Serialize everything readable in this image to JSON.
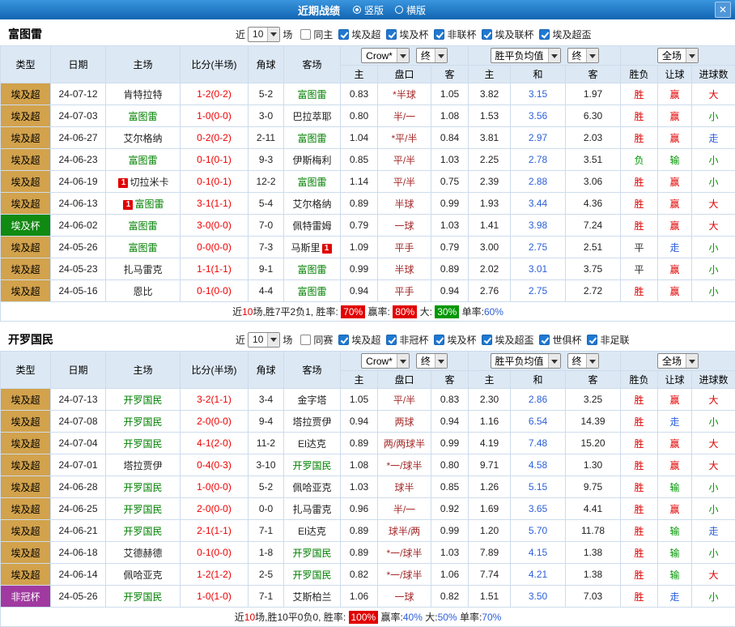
{
  "titlebar": {
    "title": "近期战绩",
    "portrait_label": "竖版",
    "landscape_label": "横版",
    "close_icon": "✕"
  },
  "colors": {
    "win": "#e10000",
    "draw": "#333333",
    "loss": "#009700",
    "push": "#2b5fd9",
    "over": "#e10000",
    "under": "#009700",
    "team": "#008000",
    "score": "#ee0000",
    "handicap": "#a52a2a",
    "league_bg": "#d2a24c",
    "cup_bg": "#118a11",
    "confed_bg": "#a03aa0"
  },
  "sections": [
    {
      "team": "富图雷",
      "filters": {
        "near_label": "近",
        "count": "10",
        "matches_label": "场",
        "checks": [
          {
            "label": "同主",
            "checked": false
          },
          {
            "label": "埃及超",
            "checked": true
          },
          {
            "label": "埃及杯",
            "checked": true
          },
          {
            "label": "非联杯",
            "checked": true
          },
          {
            "label": "埃及联杯",
            "checked": true
          },
          {
            "label": "埃及超盃",
            "checked": true
          }
        ]
      },
      "selects": {
        "book": "Crow*",
        "final1": "终",
        "avg": "胜平负均值",
        "final2": "终",
        "scope": "全场"
      },
      "cols_main": [
        "类型",
        "日期",
        "主场",
        "比分(半场)",
        "角球",
        "客场"
      ],
      "cols_sub": [
        "主",
        "盘口",
        "客",
        "主",
        "和",
        "客",
        "胜负",
        "让球",
        "进球数"
      ],
      "rows": [
        {
          "type": "埃及超",
          "tc": "league",
          "date": "24-07-12",
          "home": {
            "name": "肯特拉特"
          },
          "score": "1-2(0-2)",
          "corner": "5-2",
          "away": {
            "name": "富图雷"
          },
          "odds": [
            "0.83",
            "*半球",
            "1.05"
          ],
          "avg": [
            "3.82",
            "3.15",
            "1.97"
          ],
          "res": [
            "胜",
            "赢",
            "大"
          ]
        },
        {
          "type": "埃及超",
          "tc": "league",
          "date": "24-07-03",
          "home": {
            "name": "富图雷"
          },
          "score": "1-0(0-0)",
          "corner": "3-0",
          "away": {
            "name": "巴拉萃耶"
          },
          "odds": [
            "0.80",
            "半/一",
            "1.08"
          ],
          "avg": [
            "1.53",
            "3.56",
            "6.30"
          ],
          "res": [
            "胜",
            "赢",
            "小"
          ]
        },
        {
          "type": "埃及超",
          "tc": "league",
          "date": "24-06-27",
          "home": {
            "name": "艾尔格纳"
          },
          "score": "0-2(0-2)",
          "corner": "2-11",
          "away": {
            "name": "富图雷"
          },
          "odds": [
            "1.04",
            "*平/半",
            "0.84"
          ],
          "avg": [
            "3.81",
            "2.97",
            "2.03"
          ],
          "res": [
            "胜",
            "赢",
            "走"
          ]
        },
        {
          "type": "埃及超",
          "tc": "league",
          "date": "24-06-23",
          "home": {
            "name": "富图雷"
          },
          "score": "0-1(0-1)",
          "corner": "9-3",
          "away": {
            "name": "伊斯梅利"
          },
          "odds": [
            "0.85",
            "平/半",
            "1.03"
          ],
          "avg": [
            "2.25",
            "2.78",
            "3.51"
          ],
          "res": [
            "负",
            "输",
            "小"
          ]
        },
        {
          "type": "埃及超",
          "tc": "league",
          "date": "24-06-19",
          "home": {
            "name": "切拉米卡",
            "badge": "1",
            "badge_pos": "left"
          },
          "score": "0-1(0-1)",
          "corner": "12-2",
          "away": {
            "name": "富图雷"
          },
          "odds": [
            "1.14",
            "平/半",
            "0.75"
          ],
          "avg": [
            "2.39",
            "2.88",
            "3.06"
          ],
          "res": [
            "胜",
            "赢",
            "小"
          ]
        },
        {
          "type": "埃及超",
          "tc": "league",
          "date": "24-06-13",
          "home": {
            "name": "富图雷",
            "badge": "1",
            "badge_pos": "left"
          },
          "score": "3-1(1-1)",
          "corner": "5-4",
          "away": {
            "name": "艾尔格纳"
          },
          "odds": [
            "0.89",
            "半球",
            "0.99"
          ],
          "avg": [
            "1.93",
            "3.44",
            "4.36"
          ],
          "res": [
            "胜",
            "赢",
            "大"
          ]
        },
        {
          "type": "埃及杯",
          "tc": "cup",
          "date": "24-06-02",
          "home": {
            "name": "富图雷"
          },
          "score": "3-0(0-0)",
          "corner": "7-0",
          "away": {
            "name": "佩特雷姆"
          },
          "odds": [
            "0.79",
            "一球",
            "1.03"
          ],
          "avg": [
            "1.41",
            "3.98",
            "7.24"
          ],
          "res": [
            "胜",
            "赢",
            "大"
          ]
        },
        {
          "type": "埃及超",
          "tc": "league",
          "date": "24-05-26",
          "home": {
            "name": "富图雷"
          },
          "score": "0-0(0-0)",
          "corner": "7-3",
          "away": {
            "name": "马斯里",
            "badge": "1",
            "badge_pos": "right"
          },
          "odds": [
            "1.09",
            "平手",
            "0.79"
          ],
          "avg": [
            "3.00",
            "2.75",
            "2.51"
          ],
          "res": [
            "平",
            "走",
            "小"
          ]
        },
        {
          "type": "埃及超",
          "tc": "league",
          "date": "24-05-23",
          "home": {
            "name": "扎马雷克"
          },
          "score": "1-1(1-1)",
          "corner": "9-1",
          "away": {
            "name": "富图雷"
          },
          "odds": [
            "0.99",
            "半球",
            "0.89"
          ],
          "avg": [
            "2.02",
            "3.01",
            "3.75"
          ],
          "res": [
            "平",
            "赢",
            "小"
          ]
        },
        {
          "type": "埃及超",
          "tc": "league",
          "date": "24-05-16",
          "home": {
            "name": "恩比"
          },
          "score": "0-1(0-0)",
          "corner": "4-4",
          "away": {
            "name": "富图雷"
          },
          "odds": [
            "0.94",
            "平手",
            "0.94"
          ],
          "avg": [
            "2.76",
            "2.75",
            "2.72"
          ],
          "res": [
            "胜",
            "赢",
            "小"
          ]
        }
      ],
      "summary": [
        {
          "t": "近"
        },
        {
          "t": "10",
          "c": "red"
        },
        {
          "t": "场,胜7平2负1, 胜率: "
        },
        {
          "t": "70%",
          "c": "badge-red"
        },
        {
          "t": " 赢率: "
        },
        {
          "t": "80%",
          "c": "badge-red"
        },
        {
          "t": " 大: "
        },
        {
          "t": "30%",
          "c": "badge-green"
        },
        {
          "t": " 单率:"
        },
        {
          "t": "60%",
          "c": "blue"
        }
      ]
    },
    {
      "team": "开罗国民",
      "filters": {
        "near_label": "近",
        "count": "10",
        "matches_label": "场",
        "checks": [
          {
            "label": "同赛",
            "checked": false
          },
          {
            "label": "埃及超",
            "checked": true
          },
          {
            "label": "非冠杯",
            "checked": true
          },
          {
            "label": "埃及杯",
            "checked": true
          },
          {
            "label": "埃及超盃",
            "checked": true
          },
          {
            "label": "世俱杯",
            "checked": true
          },
          {
            "label": "非足联",
            "checked": true
          }
        ]
      },
      "selects": {
        "book": "Crow*",
        "final1": "终",
        "avg": "胜平负均值",
        "final2": "终",
        "scope": "全场"
      },
      "cols_main": [
        "类型",
        "日期",
        "主场",
        "比分(半场)",
        "角球",
        "客场"
      ],
      "cols_sub": [
        "主",
        "盘口",
        "客",
        "主",
        "和",
        "客",
        "胜负",
        "让球",
        "进球数"
      ],
      "rows": [
        {
          "type": "埃及超",
          "tc": "league",
          "date": "24-07-13",
          "home": {
            "name": "开罗国民"
          },
          "score": "3-2(1-1)",
          "corner": "3-4",
          "away": {
            "name": "金字塔"
          },
          "odds": [
            "1.05",
            "平/半",
            "0.83"
          ],
          "avg": [
            "2.30",
            "2.86",
            "3.25"
          ],
          "res": [
            "胜",
            "赢",
            "大"
          ]
        },
        {
          "type": "埃及超",
          "tc": "league",
          "date": "24-07-08",
          "home": {
            "name": "开罗国民"
          },
          "score": "2-0(0-0)",
          "corner": "9-4",
          "away": {
            "name": "塔拉贾伊"
          },
          "odds": [
            "0.94",
            "两球",
            "0.94"
          ],
          "avg": [
            "1.16",
            "6.54",
            "14.39"
          ],
          "res": [
            "胜",
            "走",
            "小"
          ]
        },
        {
          "type": "埃及超",
          "tc": "league",
          "date": "24-07-04",
          "home": {
            "name": "开罗国民"
          },
          "score": "4-1(2-0)",
          "corner": "11-2",
          "away": {
            "name": "El达克"
          },
          "odds": [
            "0.89",
            "两/两球半",
            "0.99"
          ],
          "avg": [
            "4.19",
            "7.48",
            "15.20"
          ],
          "res": [
            "胜",
            "赢",
            "大"
          ]
        },
        {
          "type": "埃及超",
          "tc": "league",
          "date": "24-07-01",
          "home": {
            "name": "塔拉贾伊"
          },
          "score": "0-4(0-3)",
          "corner": "3-10",
          "away": {
            "name": "开罗国民"
          },
          "odds": [
            "1.08",
            "*一/球半",
            "0.80"
          ],
          "avg": [
            "9.71",
            "4.58",
            "1.30"
          ],
          "res": [
            "胜",
            "赢",
            "大"
          ]
        },
        {
          "type": "埃及超",
          "tc": "league",
          "date": "24-06-28",
          "home": {
            "name": "开罗国民"
          },
          "score": "1-0(0-0)",
          "corner": "5-2",
          "away": {
            "name": "佩哈亚克"
          },
          "odds": [
            "1.03",
            "球半",
            "0.85"
          ],
          "avg": [
            "1.26",
            "5.15",
            "9.75"
          ],
          "res": [
            "胜",
            "输",
            "小"
          ]
        },
        {
          "type": "埃及超",
          "tc": "league",
          "date": "24-06-25",
          "home": {
            "name": "开罗国民"
          },
          "score": "2-0(0-0)",
          "corner": "0-0",
          "away": {
            "name": "扎马雷克"
          },
          "odds": [
            "0.96",
            "半/一",
            "0.92"
          ],
          "avg": [
            "1.69",
            "3.65",
            "4.41"
          ],
          "res": [
            "胜",
            "赢",
            "小"
          ]
        },
        {
          "type": "埃及超",
          "tc": "league",
          "date": "24-06-21",
          "home": {
            "name": "开罗国民"
          },
          "score": "2-1(1-1)",
          "corner": "7-1",
          "away": {
            "name": "El达克"
          },
          "odds": [
            "0.89",
            "球半/两",
            "0.99"
          ],
          "avg": [
            "1.20",
            "5.70",
            "11.78"
          ],
          "res": [
            "胜",
            "输",
            "走"
          ]
        },
        {
          "type": "埃及超",
          "tc": "league",
          "date": "24-06-18",
          "home": {
            "name": "艾德赫德"
          },
          "score": "0-1(0-0)",
          "corner": "1-8",
          "away": {
            "name": "开罗国民"
          },
          "odds": [
            "0.89",
            "*一/球半",
            "1.03"
          ],
          "avg": [
            "7.89",
            "4.15",
            "1.38"
          ],
          "res": [
            "胜",
            "输",
            "小"
          ]
        },
        {
          "type": "埃及超",
          "tc": "league",
          "date": "24-06-14",
          "home": {
            "name": "佩哈亚克"
          },
          "score": "1-2(1-2)",
          "corner": "2-5",
          "away": {
            "name": "开罗国民"
          },
          "odds": [
            "0.82",
            "*一/球半",
            "1.06"
          ],
          "avg": [
            "7.74",
            "4.21",
            "1.38"
          ],
          "res": [
            "胜",
            "输",
            "大"
          ]
        },
        {
          "type": "非冠杯",
          "tc": "confed",
          "date": "24-05-26",
          "home": {
            "name": "开罗国民"
          },
          "score": "1-0(1-0)",
          "corner": "7-1",
          "away": {
            "name": "艾斯柏兰"
          },
          "odds": [
            "1.06",
            "一球",
            "0.82"
          ],
          "avg": [
            "1.51",
            "3.50",
            "7.03"
          ],
          "res": [
            "胜",
            "走",
            "小"
          ]
        }
      ],
      "summary": [
        {
          "t": "近"
        },
        {
          "t": "10",
          "c": "red"
        },
        {
          "t": "场,胜10平0负0, 胜率: "
        },
        {
          "t": "100%",
          "c": "badge-red"
        },
        {
          "t": " 赢率:"
        },
        {
          "t": "40%",
          "c": "blue"
        },
        {
          "t": " 大:"
        },
        {
          "t": "50%",
          "c": "blue"
        },
        {
          "t": " 单率:"
        },
        {
          "t": "70%",
          "c": "blue"
        }
      ]
    }
  ]
}
